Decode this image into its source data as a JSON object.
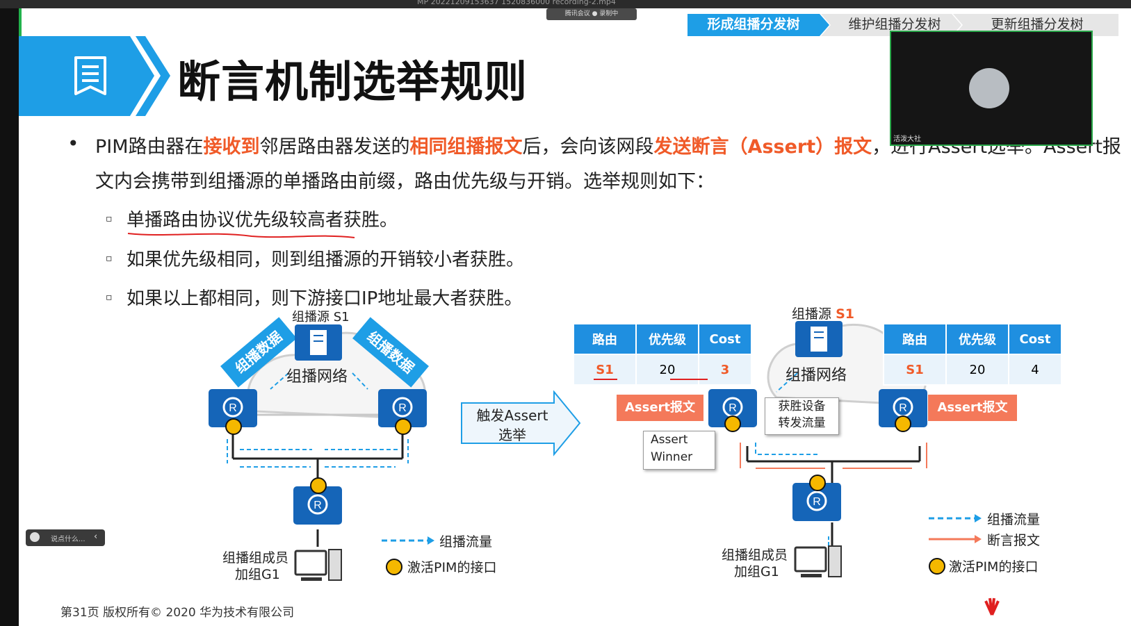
{
  "window": {
    "file_name": "MP 20221209153637 1520836000 recording-2.mp4",
    "meeting_pill": "腾讯会议 ● 录制中"
  },
  "slide": {
    "title": "断言机制选举规则",
    "tabs": [
      "形成组播分发树",
      "维护组播分发树",
      "更新组播分发树"
    ],
    "bullet": {
      "p1": "PIM路由器在",
      "h1": "接收到",
      "p2": "邻居路由器发送的",
      "h2": "相同组播报文",
      "p3": "后，会向该网段",
      "h3": "发送断言（Assert）报文",
      "p4": "，进行Assert选举。Assert报文内会携带到组播源的单播路由前缀，路由优先级与开销。选举规则如下："
    },
    "rules": [
      "单播路由协议优先级较高者获胜。",
      "如果优先级相同，则到组播源的开销较小者获胜。",
      "如果以上都相同，则下游接口IP地址最大者获胜。"
    ],
    "footer": "第31页     版权所有© 2020 华为技术有限公司"
  },
  "diagram_left": {
    "source_label": "组播源 S1",
    "network_label": "组播网络",
    "data_tag_left": "组播数据",
    "data_tag_right": "组播数据",
    "member_label_1": "组播组成员",
    "member_label_2": "加组G1",
    "legend_flow": "组播流量",
    "legend_pim": "激活PIM的接口"
  },
  "trigger_arrow": {
    "line1": "触发Assert",
    "line2": "选举"
  },
  "diagram_right": {
    "source_label": "组播源",
    "source_name": "S1",
    "network_label": "组播网络",
    "table_headers": [
      "路由",
      "优先级",
      "Cost"
    ],
    "left_table": [
      "S1",
      "20",
      "3"
    ],
    "right_table": [
      "S1",
      "20",
      "4"
    ],
    "assert_tag": "Assert报文",
    "winner_box": {
      "line1": "获胜设备",
      "line2": "转发流量"
    },
    "assert_winner": {
      "line1": "Assert",
      "line2": "Winner"
    },
    "member_label_1": "组播组成员",
    "member_label_2": "加组G1",
    "legend_flow": "组播流量",
    "legend_assert": "断言报文",
    "legend_pim": "激活PIM的接口"
  },
  "video": {
    "participant": "活泼大社"
  },
  "chat": {
    "placeholder": "说点什么..."
  },
  "colors": {
    "accent_blue": "#1e9ee6",
    "highlight_orange": "#f05a28",
    "assert_orange": "#f4795a",
    "router_blue": "#1565b8",
    "pim_yellow": "#f5b800"
  }
}
